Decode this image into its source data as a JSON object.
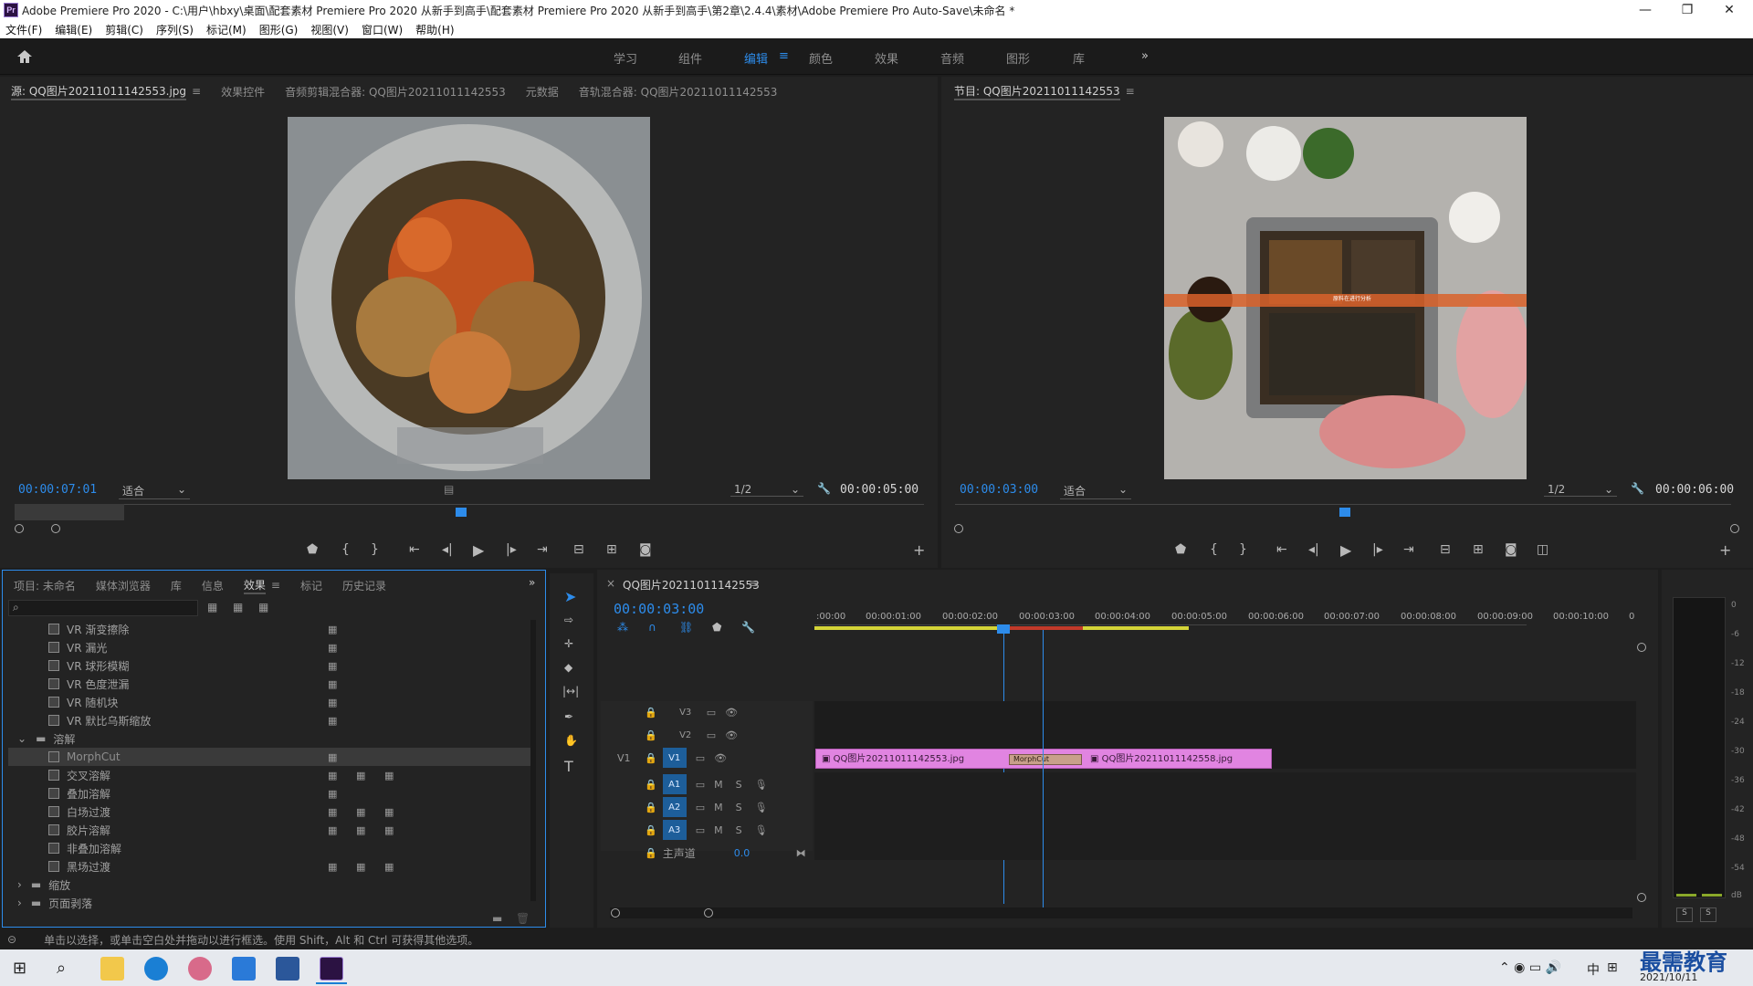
{
  "titlebar": {
    "icon": "Pr",
    "title": "Adobe Premiere Pro 2020 - C:\\用户\\hbxy\\桌面\\配套素材 Premiere Pro 2020 从新手到高手\\配套素材 Premiere Pro 2020 从新手到高手\\第2章\\2.4.4\\素材\\Adobe Premiere Pro Auto-Save\\未命名 *",
    "minimize": "—",
    "maximize": "❐",
    "close": "✕"
  },
  "menu": [
    "文件(F)",
    "编辑(E)",
    "剪辑(C)",
    "序列(S)",
    "标记(M)",
    "图形(G)",
    "视图(V)",
    "窗口(W)",
    "帮助(H)"
  ],
  "workspaces": {
    "items": [
      "学习",
      "组件",
      "编辑",
      "颜色",
      "效果",
      "音频",
      "图形",
      "库"
    ],
    "active": "编辑",
    "more": "»",
    "menu_icon": "≡"
  },
  "source_panel": {
    "tabs": [
      "源: QQ图片20211011142553.jpg",
      "效果控件",
      "音频剪辑混合器: QQ图片20211011142553",
      "元数据",
      "音轨混合器: QQ图片20211011142553"
    ],
    "menu_glyph": "≡",
    "timecode": "00:00:07:01",
    "fit": "适合",
    "resolution": "1/2",
    "duration": "00:00:05:00"
  },
  "program_panel": {
    "title": "节目: QQ图片20211011142553",
    "menu_glyph": "≡",
    "timecode": "00:00:03:00",
    "fit": "适合",
    "resolution": "1/2",
    "duration": "00:00:06:00",
    "overlay_text": "原料在进行分析"
  },
  "project_panel": {
    "tabs": [
      "项目: 未命名",
      "媒体浏览器",
      "库",
      "信息",
      "效果",
      "标记",
      "历史记录"
    ],
    "active_tab": "效果",
    "more": "»",
    "search_placeholder": "",
    "items": [
      {
        "label": "VR 渐变擦除",
        "type": "effect",
        "acc": 1
      },
      {
        "label": "VR 漏光",
        "type": "effect",
        "acc": 1
      },
      {
        "label": "VR 球形模糊",
        "type": "effect",
        "acc": 1
      },
      {
        "label": "VR 色度泄漏",
        "type": "effect",
        "acc": 1
      },
      {
        "label": "VR 随机块",
        "type": "effect",
        "acc": 1
      },
      {
        "label": "VR 默比乌斯缩放",
        "type": "effect",
        "acc": 1
      },
      {
        "label": "溶解",
        "type": "folder-open"
      },
      {
        "label": "MorphCut",
        "type": "effect-selected",
        "acc": 1
      },
      {
        "label": "交叉溶解",
        "type": "effect",
        "acc": 3
      },
      {
        "label": "叠加溶解",
        "type": "effect",
        "acc": 1
      },
      {
        "label": "白场过渡",
        "type": "effect",
        "acc": 3
      },
      {
        "label": "胶片溶解",
        "type": "effect",
        "acc": 3
      },
      {
        "label": "非叠加溶解",
        "type": "effect",
        "acc": 0
      },
      {
        "label": "黑场过渡",
        "type": "effect",
        "acc": 3
      },
      {
        "label": "缩放",
        "type": "folder-closed"
      },
      {
        "label": "页面剥落",
        "type": "folder-closed"
      }
    ]
  },
  "timeline": {
    "title": "QQ图片20211011142553",
    "close": "×",
    "menu_glyph": "≡",
    "timecode": "00:00:03:00",
    "ruler": [
      ":00:00",
      "00:00:01:00",
      "00:00:02:00",
      "00:00:03:00",
      "00:00:04:00",
      "00:00:05:00",
      "00:00:06:00",
      "00:00:07:00",
      "00:00:08:00",
      "00:00:09:00",
      "00:00:10:00",
      "0"
    ],
    "video_tracks": [
      "V3",
      "V2",
      "V1"
    ],
    "audio_tracks": [
      "A1",
      "A2",
      "A3"
    ],
    "source_patch_v": "V1",
    "mute": "M",
    "solo": "S",
    "master": {
      "label": "主声道",
      "value": "0.0"
    },
    "clips": [
      {
        "label": "QQ图片20211011142553.jpg"
      },
      {
        "label": "QQ图片20211011142558.jpg"
      }
    ],
    "transition": "MorphCut"
  },
  "meter": {
    "labels": [
      "0",
      "-6",
      "-12",
      "-18",
      "-24",
      "-30",
      "-36",
      "-42",
      "-48",
      "-54",
      "dB"
    ],
    "solo_buttons": [
      "S",
      "S"
    ]
  },
  "status_bar": "单击以选择，或单击空白处并拖动以进行框选。使用 Shift，Alt 和 Ctrl 可获得其他选项。",
  "taskbar": {
    "clock": "2021/10/11",
    "ime": "中",
    "watermark": "最需教育"
  }
}
